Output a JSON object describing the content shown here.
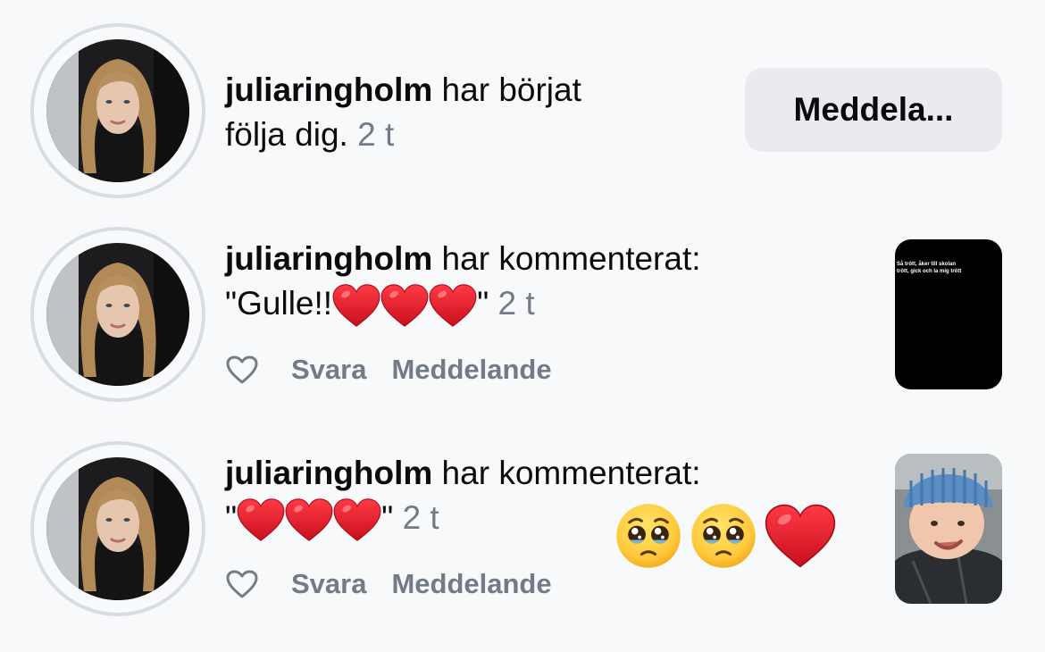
{
  "notifications": [
    {
      "username": "juliaringholm",
      "action_line1": " har börjat",
      "action_line2": "följa dig.",
      "time": "2 t",
      "button_label": "Meddela..."
    },
    {
      "username": "juliaringholm",
      "action": " har kommenterat:",
      "quote_open": "\"Gulle!!",
      "quote_close": "\"",
      "time": "2 t",
      "reply_label": "Svara",
      "message_label": "Meddelande",
      "thumbnail_text": "Så trött, åker till skolan trött, gick och la mig trött"
    },
    {
      "username": "juliaringholm",
      "action": " har kommenterat:",
      "quote_open": "\"",
      "quote_close": "\"",
      "time": "2 t",
      "reply_label": "Svara",
      "message_label": "Meddelande",
      "reaction_emoji": [
        "pleading-face",
        "pleading-face",
        "red-heart"
      ]
    }
  ],
  "colors": {
    "background": "#f8f9fb",
    "muted_text": "#737b88",
    "button_bg": "#e9ebef",
    "heart_red": "#e0182c"
  }
}
